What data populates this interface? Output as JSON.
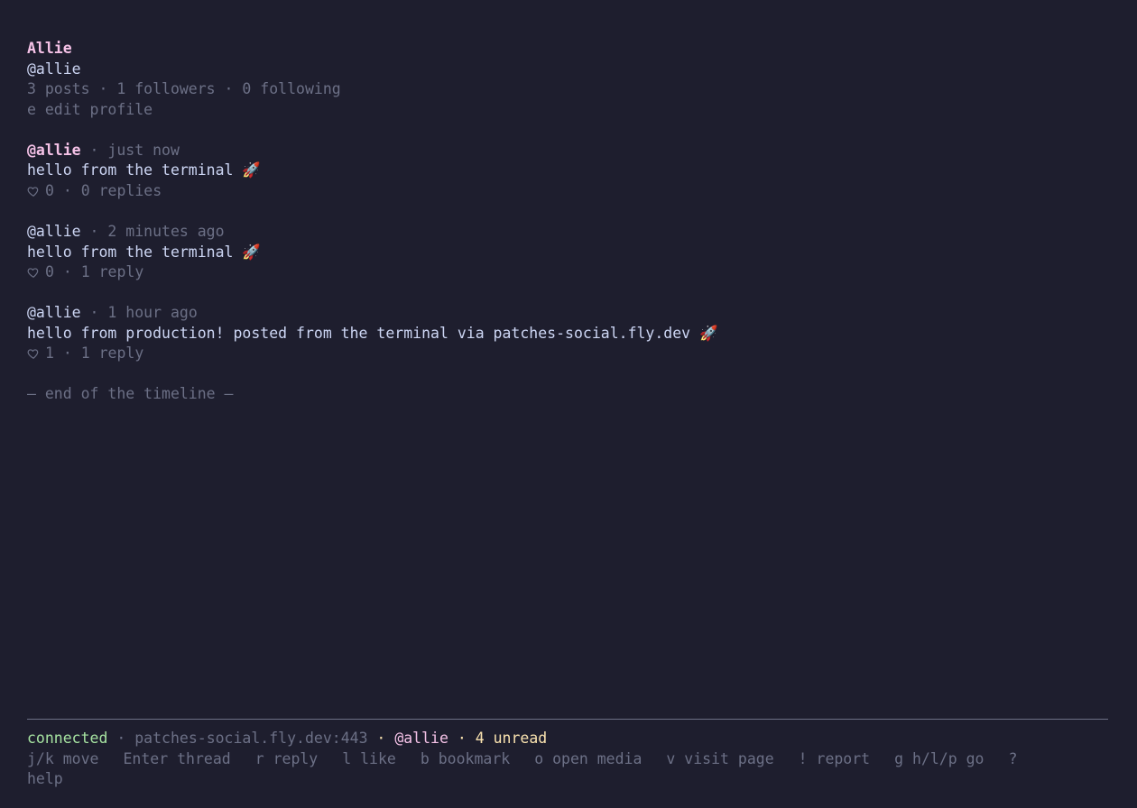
{
  "profile": {
    "display_name": "Allie",
    "handle": "@allie",
    "stats": "3 posts · 1 followers · 0 following",
    "edit_hint": "e edit profile"
  },
  "posts": [
    {
      "author": "@allie",
      "time": " · just now",
      "body": "hello from the terminal 🚀",
      "likes": "0",
      "replies": " · 0 replies",
      "selected": true
    },
    {
      "author": "@allie",
      "time": " · 2 minutes ago",
      "body": "hello from the terminal 🚀",
      "likes": "0",
      "replies": " · 1 reply",
      "selected": false
    },
    {
      "author": "@allie",
      "time": " · 1 hour ago",
      "body": "hello from production! posted from the terminal via patches-social.fly.dev 🚀",
      "likes": "1",
      "replies": " · 1 reply",
      "selected": false
    }
  ],
  "timeline_end": "— end of the timeline —",
  "status": {
    "connection": "connected",
    "sep1": " · ",
    "server": "patches-social.fly.dev:443",
    "sep2": " · ",
    "user": "@allie",
    "sep3": " · ",
    "unread": "4 unread"
  },
  "keys": [
    "j/k move",
    "Enter thread",
    "r reply",
    "l like",
    "b bookmark",
    "o open media",
    "v visit page",
    "! report",
    "g h/l/p go",
    "?",
    "help"
  ],
  "colors": {
    "background": "#1e1e2e",
    "accent": "#f5c2e7",
    "connected": "#a6e3a1",
    "unread": "#f9e2af",
    "dim": "#6c7086",
    "text": "#cdd6f4"
  },
  "icons": {
    "like": "heart-outline-icon"
  }
}
